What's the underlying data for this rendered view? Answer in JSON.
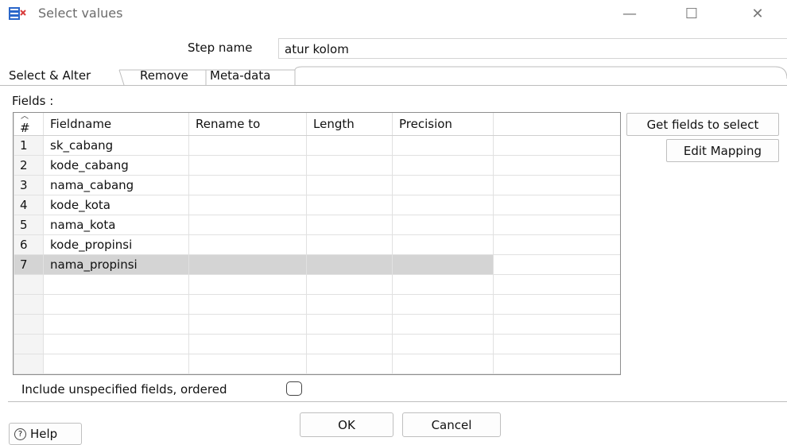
{
  "window": {
    "title": "Select values",
    "icon": "select-values-icon",
    "controls": {
      "minimize": "—",
      "maximize": "☐",
      "close": "✕"
    }
  },
  "step": {
    "label": "Step name",
    "value": "atur kolom"
  },
  "tabs": [
    {
      "label": "Select & Alter",
      "active": true
    },
    {
      "label": "Remove",
      "active": false
    },
    {
      "label": "Meta-data",
      "active": false
    }
  ],
  "fields": {
    "label": "Fields :",
    "columns": [
      "#",
      "Fieldname",
      "Rename to",
      "Length",
      "Precision"
    ],
    "rows": [
      {
        "num": "1",
        "fieldname": "sk_cabang",
        "rename": "",
        "length": "",
        "precision": ""
      },
      {
        "num": "2",
        "fieldname": "kode_cabang",
        "rename": "",
        "length": "",
        "precision": ""
      },
      {
        "num": "3",
        "fieldname": "nama_cabang",
        "rename": "",
        "length": "",
        "precision": ""
      },
      {
        "num": "4",
        "fieldname": "kode_kota",
        "rename": "",
        "length": "",
        "precision": ""
      },
      {
        "num": "5",
        "fieldname": "nama_kota",
        "rename": "",
        "length": "",
        "precision": ""
      },
      {
        "num": "6",
        "fieldname": "kode_propinsi",
        "rename": "",
        "length": "",
        "precision": ""
      },
      {
        "num": "7",
        "fieldname": "nama_propinsi",
        "rename": "",
        "length": "",
        "precision": ""
      }
    ],
    "selected_row": "7"
  },
  "side_buttons": {
    "get_fields": "Get fields to select",
    "edit_mapping": "Edit Mapping"
  },
  "include_unspecified": {
    "label": "Include unspecified fields, ordered",
    "checked": false
  },
  "footer": {
    "help": "Help",
    "ok": "OK",
    "cancel": "Cancel"
  },
  "colors": {
    "selected_row": "#d4d4d4",
    "row_header": "#f4f4f4",
    "title_text": "#6b6b6b"
  }
}
